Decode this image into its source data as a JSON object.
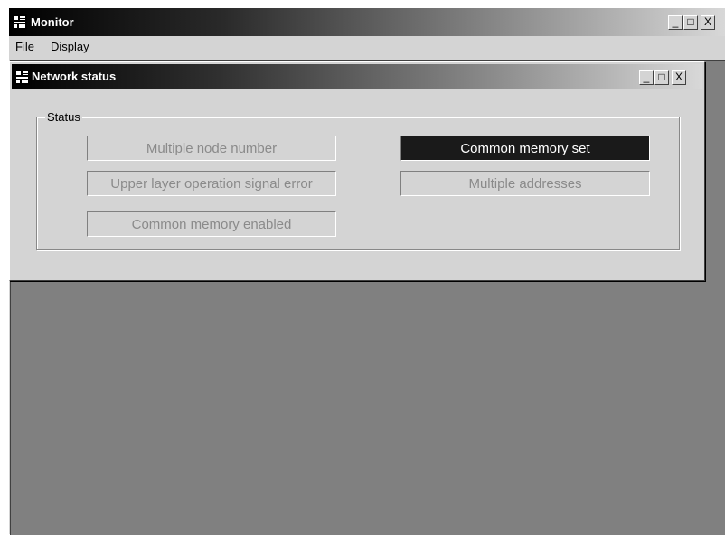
{
  "app": {
    "title": "Monitor",
    "icon": "monitor-app-icon",
    "controls": {
      "minimize": "_",
      "maximize": "□",
      "close": "X"
    }
  },
  "menu": {
    "items": [
      {
        "label": "File",
        "underline": "F"
      },
      {
        "label": "Display",
        "underline": "D"
      }
    ]
  },
  "child_window": {
    "title": "Network status",
    "icon": "network-window-icon",
    "controls": {
      "minimize": "_",
      "maximize": "□",
      "close": "X"
    }
  },
  "status_group": {
    "label": "Status",
    "indicators": [
      {
        "label": "Multiple node number",
        "active": false
      },
      {
        "label": "Common memory set",
        "active": true
      },
      {
        "label": "Upper layer operation signal error",
        "active": false
      },
      {
        "label": "Multiple addresses",
        "active": false
      },
      {
        "label": "Common memory enabled",
        "active": false
      }
    ]
  },
  "colors": {
    "active_indicator_bg": "#1a1a1a",
    "inactive_indicator_text": "#8a8a8a",
    "mdi_background": "#808080"
  }
}
